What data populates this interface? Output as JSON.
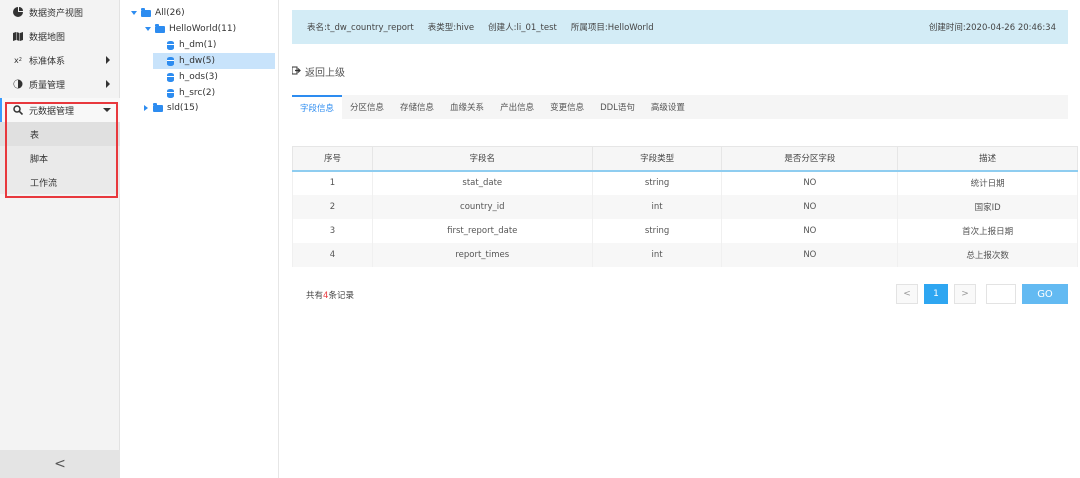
{
  "nav": {
    "items": [
      {
        "label": "数据资产视图",
        "icon": "pie-chart-icon"
      },
      {
        "label": "数据地图",
        "icon": "map-icon"
      },
      {
        "label": "标准体系",
        "icon": "formula-icon"
      },
      {
        "label": "质量管理",
        "icon": "shield-icon"
      },
      {
        "label": "元数据管理",
        "icon": "search-icon"
      }
    ],
    "sub_items": [
      {
        "label": "表"
      },
      {
        "label": "脚本"
      },
      {
        "label": "工作流"
      }
    ],
    "collapse_label": "<",
    "highlight_color": "#e8383d"
  },
  "tree": {
    "root": "All(26)",
    "project": "HelloWorld(11)",
    "dbs": [
      "h_dm(1)",
      "h_dw(5)",
      "h_ods(3)",
      "h_src(2)"
    ],
    "other": "sld(15)"
  },
  "info": {
    "table_name": "表名:t_dw_country_report",
    "table_type": "表类型:hive",
    "creator": "创建人:li_01_test",
    "project": "所属项目:HelloWorld",
    "created_time": "创建时间:2020-04-26 20:46:34"
  },
  "back_label": "返回上级",
  "tabs": [
    "字段信息",
    "分区信息",
    "存储信息",
    "血缘关系",
    "产出信息",
    "变更信息",
    "DDL语句",
    "高级设置"
  ],
  "table": {
    "headers": [
      "序号",
      "字段名",
      "字段类型",
      "是否分区字段",
      "描述"
    ],
    "rows": [
      [
        "1",
        "stat_date",
        "string",
        "NO",
        "统计日期"
      ],
      [
        "2",
        "country_id",
        "int",
        "NO",
        "国家ID"
      ],
      [
        "3",
        "first_report_date",
        "string",
        "NO",
        "首次上报日期"
      ],
      [
        "4",
        "report_times",
        "int",
        "NO",
        "总上报次数"
      ]
    ]
  },
  "footer": {
    "total_prefix": "共有",
    "total_count": "4",
    "total_suffix": "条记录"
  },
  "pager": {
    "prev": "<",
    "current": "1",
    "next": ">",
    "go_label": "GO"
  },
  "colors": {
    "accent": "#2d8cf0",
    "info_bar": "#d3ecf6",
    "go_button": "#63baf2"
  }
}
